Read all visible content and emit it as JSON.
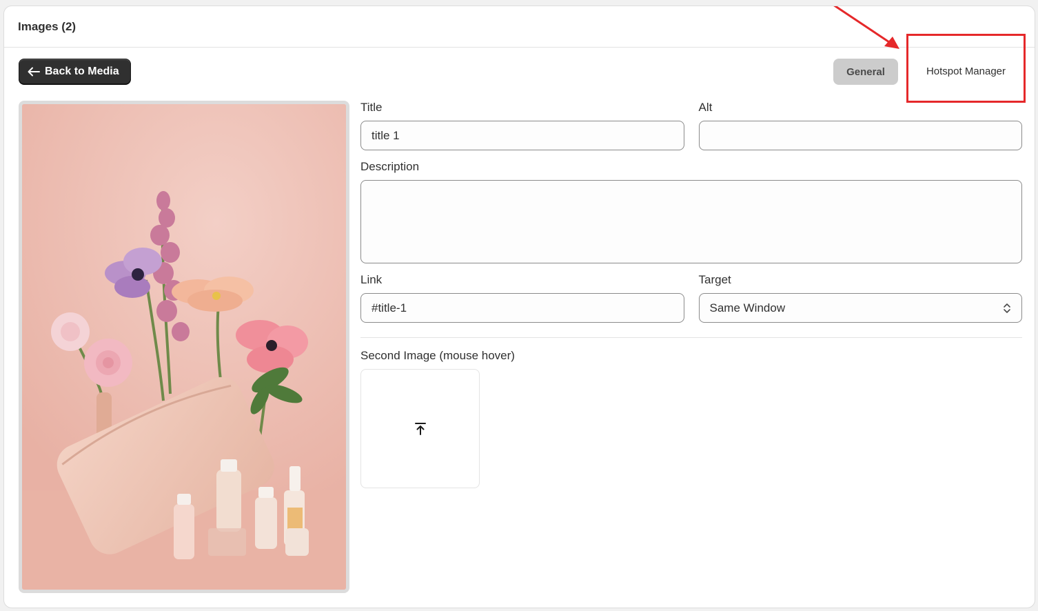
{
  "card": {
    "title": "Images (2)"
  },
  "toolbar": {
    "back_label": "Back to Media"
  },
  "tabs": [
    {
      "label": "General",
      "active": true
    },
    {
      "label": "Hotspot Manager",
      "active": false
    }
  ],
  "form": {
    "title": {
      "label": "Title",
      "value": "title 1"
    },
    "alt": {
      "label": "Alt",
      "value": ""
    },
    "description": {
      "label": "Description",
      "value": ""
    },
    "link": {
      "label": "Link",
      "value": "#title-1"
    },
    "target": {
      "label": "Target",
      "value": "Same Window"
    },
    "second_image": {
      "label": "Second Image (mouse hover)"
    }
  },
  "icons": {
    "back": "arrow-left-icon",
    "select": "select-chevrons-icon",
    "upload": "upload-icon"
  },
  "colors": {
    "primary_button": "#303030",
    "annotation": "#e5282a",
    "active_tab": "#cccccc"
  }
}
